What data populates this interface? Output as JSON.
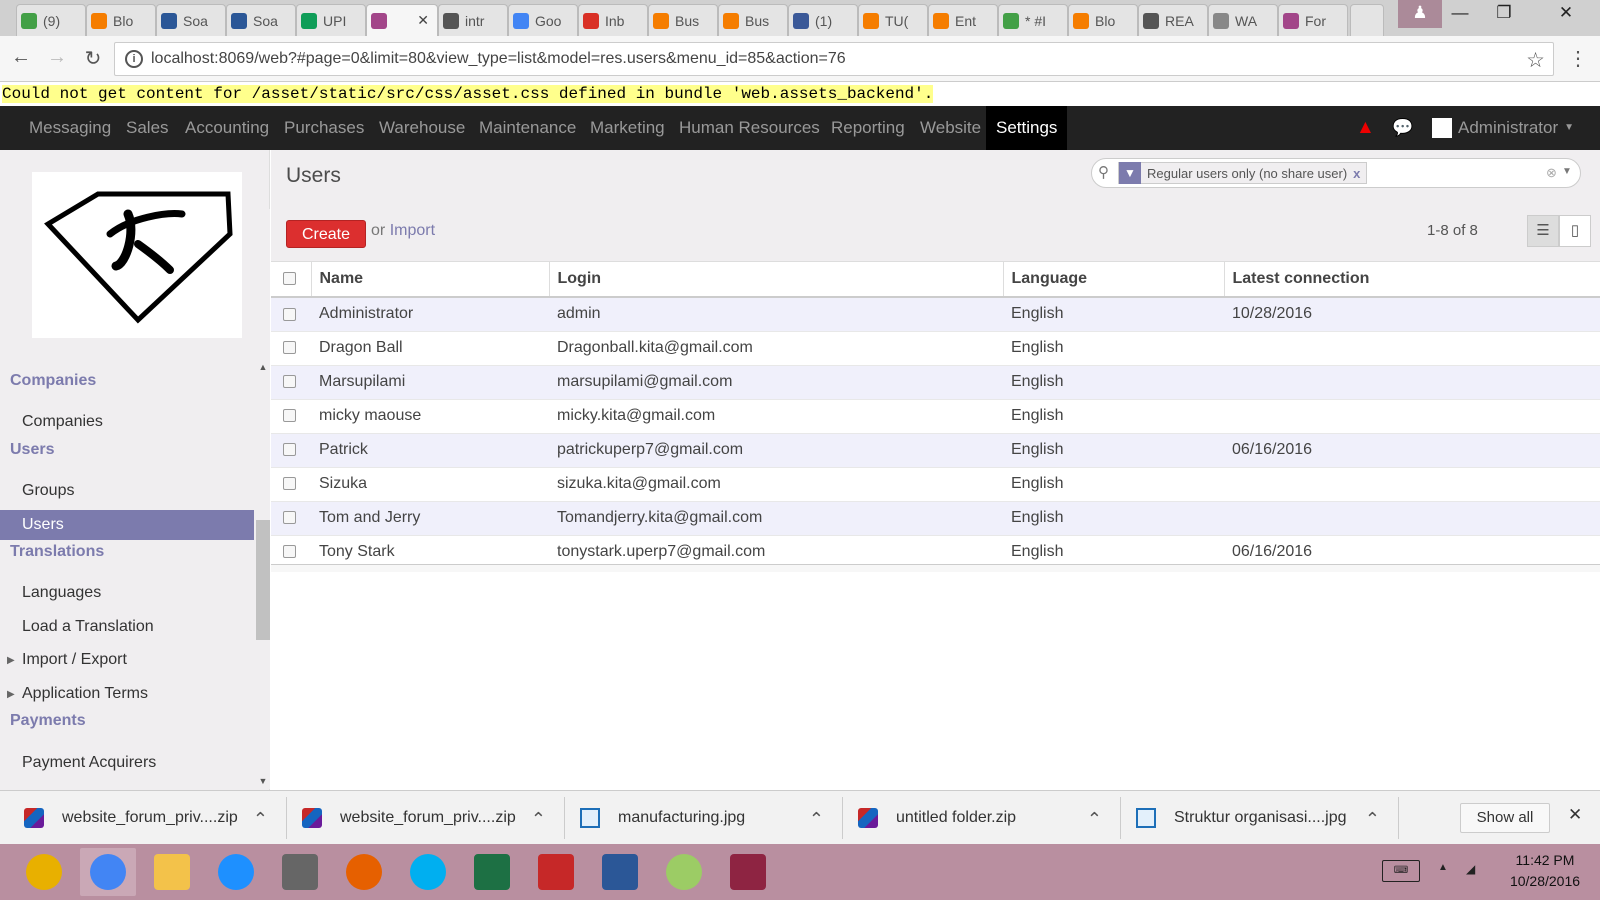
{
  "browser": {
    "tabs": [
      {
        "label": "(9)",
        "icon": "whatsapp-icon",
        "color": "#43a047"
      },
      {
        "label": "Blo",
        "icon": "blogger-icon",
        "color": "#f57d00"
      },
      {
        "label": "Soa",
        "icon": "w-icon",
        "color": "#2b5797"
      },
      {
        "label": "Soa",
        "icon": "w-icon",
        "color": "#2b5797"
      },
      {
        "label": "UPI",
        "icon": "drive-icon",
        "color": "#0f9d58"
      },
      {
        "label": "",
        "icon": "odoo-icon",
        "color": "#a24689",
        "active": true
      },
      {
        "label": "intr",
        "icon": "book-icon",
        "color": "#555555"
      },
      {
        "label": "Goo",
        "icon": "google-icon",
        "color": "#4285f4"
      },
      {
        "label": "Inb",
        "icon": "gmail-icon",
        "color": "#d93025"
      },
      {
        "label": "Bus",
        "icon": "blogger-icon",
        "color": "#f57d00"
      },
      {
        "label": "Bus",
        "icon": "blogger-icon",
        "color": "#f57d00"
      },
      {
        "label": "(1)",
        "icon": "facebook-icon",
        "color": "#3b5998"
      },
      {
        "label": "TU(",
        "icon": "blogger-icon",
        "color": "#f57d00"
      },
      {
        "label": "Ent",
        "icon": "blogger-icon",
        "color": "#f57d00"
      },
      {
        "label": "* #I",
        "icon": "odoo-icon",
        "color": "#43a047"
      },
      {
        "label": "Blo",
        "icon": "blogger-icon",
        "color": "#f57d00"
      },
      {
        "label": "REA",
        "icon": "book-icon",
        "color": "#555555"
      },
      {
        "label": "WA",
        "icon": "page-icon",
        "color": "#888888"
      },
      {
        "label": "For",
        "icon": "odoo-icon",
        "color": "#a24689"
      }
    ],
    "url": "localhost:8069/web?#page=0&limit=80&view_type=list&model=res.users&menu_id=85&action=76"
  },
  "error_message": "Could not get content for /asset/static/src/css/asset.css defined in bundle 'web.assets_backend'.",
  "topnav": {
    "items": [
      "Messaging",
      "Sales",
      "Accounting",
      "Purchases",
      "Warehouse",
      "Maintenance",
      "Marketing",
      "Human Resources",
      "Reporting",
      "Website",
      "Settings"
    ],
    "active": "Settings",
    "user": "Administrator"
  },
  "sidebar": {
    "sections": [
      {
        "heading": "Companies",
        "items": [
          "Companies"
        ]
      },
      {
        "heading": "Users",
        "items": [
          "Groups",
          "Users"
        ]
      },
      {
        "heading": "Translations",
        "items": [
          "Languages",
          "Load a Translation",
          "Import / Export",
          "Application Terms"
        ]
      },
      {
        "heading": "Payments",
        "items": [
          "Payment Acquirers"
        ]
      }
    ],
    "active_item": "Users"
  },
  "content": {
    "title": "Users",
    "search_facet": "Regular users only (no share user)",
    "facet_remove": "x",
    "create_label": "Create",
    "or_label": "or",
    "import_label": "Import",
    "pager": "1-8 of 8"
  },
  "table": {
    "columns": [
      "Name",
      "Login",
      "Language",
      "Latest connection"
    ],
    "rows": [
      [
        "Administrator",
        "admin",
        "English",
        "10/28/2016"
      ],
      [
        "Dragon Ball",
        "Dragonball.kita@gmail.com",
        "English",
        ""
      ],
      [
        "Marsupilami",
        "marsupilami@gmail.com",
        "English",
        ""
      ],
      [
        "micky maouse",
        "micky.kita@gmail.com",
        "English",
        ""
      ],
      [
        "Patrick",
        "patrickuperp7@gmail.com",
        "English",
        "06/16/2016"
      ],
      [
        "Sizuka",
        "sizuka.kita@gmail.com",
        "English",
        ""
      ],
      [
        "Tom and Jerry",
        "Tomandjerry.kita@gmail.com",
        "English",
        ""
      ],
      [
        "Tony Stark",
        "tonystark.uperp7@gmail.com",
        "English",
        "06/16/2016"
      ]
    ]
  },
  "downloads": {
    "items": [
      {
        "name": "website_forum_priv....zip",
        "icon": "archive-icon"
      },
      {
        "name": "website_forum_priv....zip",
        "icon": "archive-icon"
      },
      {
        "name": "manufacturing.jpg",
        "icon": "image-icon"
      },
      {
        "name": "untitled folder.zip",
        "icon": "archive-icon"
      },
      {
        "name": "Struktur organisasi....jpg",
        "icon": "image-icon"
      }
    ],
    "show_all": "Show all"
  },
  "taskbar": {
    "apps": [
      {
        "name": "start",
        "color": "#e8b000"
      },
      {
        "name": "chrome",
        "color": "#4285f4"
      },
      {
        "name": "explorer",
        "color": "#f3c24a"
      },
      {
        "name": "ie",
        "color": "#1e90ff"
      },
      {
        "name": "printer",
        "color": "#666666"
      },
      {
        "name": "firefox",
        "color": "#e66000"
      },
      {
        "name": "skype",
        "color": "#00aff0"
      },
      {
        "name": "excel",
        "color": "#1d7044"
      },
      {
        "name": "acrobat",
        "color": "#c62828"
      },
      {
        "name": "word",
        "color": "#2b5797"
      },
      {
        "name": "paint",
        "color": "#9ccc65"
      },
      {
        "name": "winrar",
        "color": "#8e2442"
      }
    ],
    "time": "11:42 PM",
    "date": "10/28/2016"
  },
  "colors": {
    "accent": "#7c7bad",
    "create": "#dc2f2f",
    "nav_bg": "#222222"
  }
}
